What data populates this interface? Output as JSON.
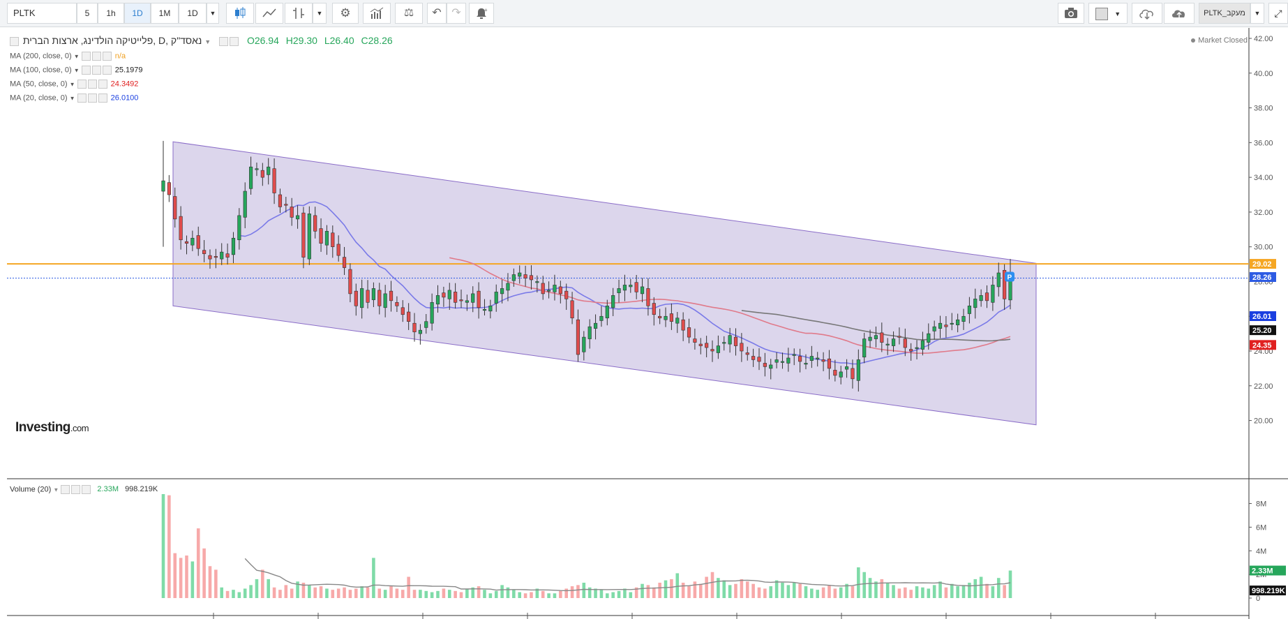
{
  "toolbar": {
    "symbol": "PLTK",
    "intervals": [
      "5",
      "1h",
      "1D",
      "1M",
      "1D"
    ],
    "active_interval_index": 2,
    "watchlist_label": "PLTK_מעקב"
  },
  "legend": {
    "title": "נאסד\"ק ,D ,פלייטיקה הולדינג, ארצות הברית",
    "open": "O26.94",
    "high": "H29.30",
    "low": "L26.40",
    "close": "C28.26",
    "ma": [
      {
        "label": "MA (200, close, 0)",
        "value": "n/a",
        "color": "#f0a020"
      },
      {
        "label": "MA (100, close, 0)",
        "value": "25.1979",
        "color": "#222222"
      },
      {
        "label": "MA (50, close, 0)",
        "value": "24.3492",
        "color": "#e02020"
      },
      {
        "label": "MA (20, close, 0)",
        "value": "26.0100",
        "color": "#1a3fe0"
      }
    ],
    "market_status": "Market Closed"
  },
  "volume_legend": {
    "label": "Volume (20)",
    "value1": "2.33M",
    "value2": "998.219K"
  },
  "logo": {
    "main": "Investing",
    "suffix": ".com"
  },
  "colors": {
    "up": "#26a65b",
    "down": "#e04c4c",
    "channel_fill": "#d8d2ea",
    "channel_stroke": "#8a6cc8",
    "horizontal_line": "#f5a623",
    "price_line": "#2d5be3",
    "ma20": "#7a7ae8",
    "ma50": "#e07a8a",
    "ma100": "#777777"
  },
  "chart_data": {
    "type": "candlestick",
    "y_axis": {
      "ticks": [
        "42.00",
        "40.00",
        "38.00",
        "36.00",
        "34.00",
        "32.00",
        "30.00",
        "28.00",
        "26.00",
        "24.00",
        "22.00",
        "20.00"
      ],
      "range": [
        19.3,
        42
      ]
    },
    "price_labels": [
      {
        "value": 29.02,
        "text": "29.02",
        "color": "#f5a623"
      },
      {
        "value": 28.26,
        "text": "28.26",
        "color": "#2d5be3"
      },
      {
        "value": 26.01,
        "text": "26.01",
        "color": "#1a3fe0"
      },
      {
        "value": 25.2,
        "text": "25.20",
        "color": "#111111"
      },
      {
        "value": 24.35,
        "text": "24.35",
        "color": "#e02020"
      }
    ],
    "horizontal_line": 29.02,
    "channel": {
      "upper": [
        36.05,
        29.05
      ],
      "lower": [
        26.6,
        19.75
      ]
    },
    "series": [
      {
        "name": "Price",
        "closes": [
          33.8,
          33.0,
          31.6,
          30.4,
          30.2,
          30.5,
          29.9,
          29.6,
          29.3,
          29.4,
          29.7,
          29.4,
          30.5,
          31.8,
          33.2,
          34.6,
          34.5,
          34.0,
          34.6,
          33.1,
          32.3,
          32.4,
          31.7,
          31.8,
          29.4,
          31.9,
          30.9,
          30.2,
          30.9,
          30.0,
          29.5,
          28.8,
          27.3,
          26.6,
          27.6,
          26.8,
          27.6,
          26.6,
          27.3,
          26.9,
          26.6,
          26.1,
          25.7,
          25.1,
          25.2,
          25.7,
          26.8,
          27.2,
          27.1,
          27.5,
          26.8,
          26.9,
          26.9,
          27.3,
          26.5,
          26.4,
          26.6,
          27.4,
          27.6,
          27.9,
          28.4,
          28.5,
          28.2,
          28.1,
          28.0,
          27.3,
          27.5,
          27.8,
          27.3,
          27.0,
          25.9,
          23.8,
          24.8,
          25.4,
          25.6,
          26.0,
          26.6,
          27.2,
          27.6,
          27.8,
          27.8,
          27.4,
          27.7,
          26.6,
          26.1,
          25.9,
          26.0,
          25.7,
          25.9,
          25.2,
          24.8,
          24.5,
          24.3,
          24.2,
          24.0,
          24.3,
          24.5,
          24.9,
          24.3,
          24.0,
          23.8,
          23.5,
          23.4,
          23.1,
          23.2,
          23.5,
          23.4,
          23.6,
          23.8,
          23.4,
          23.3,
          23.7,
          23.6,
          23.4,
          23.0,
          22.6,
          22.8,
          23.1,
          22.4,
          23.5,
          24.7,
          24.8,
          24.9,
          24.5,
          24.4,
          24.7,
          24.8,
          24.2,
          24.0,
          24.2,
          24.6,
          25.0,
          25.4,
          25.6,
          25.4,
          25.6,
          25.8,
          26.0,
          26.6,
          27.0,
          27.2,
          26.9,
          27.8,
          28.5,
          27.0,
          28.2
        ]
      },
      {
        "name": "MA (20, close, 0)",
        "values_from_index": 13
      },
      {
        "name": "MA (50, close, 0)",
        "values_from_index": 49
      },
      {
        "name": "MA (100, close, 0)",
        "values_from_index": 99
      }
    ],
    "volume": {
      "y_ticks": [
        "8M",
        "6M",
        "4M",
        "2M",
        "0"
      ],
      "range": [
        0,
        8.8
      ],
      "last_label": "2.33M",
      "ma_label": "998.219K",
      "values": [
        8.8,
        8.7,
        3.8,
        3.4,
        3.6,
        3.1,
        5.9,
        4.2,
        2.7,
        2.4,
        0.9,
        0.6,
        0.7,
        0.5,
        0.8,
        1.1,
        1.6,
        2.4,
        1.6,
        0.9,
        0.7,
        1.1,
        0.8,
        1.4,
        1.3,
        1.1,
        0.9,
        1.0,
        0.8,
        0.7,
        0.8,
        0.9,
        0.7,
        0.8,
        1.0,
        0.9,
        3.4,
        0.8,
        0.7,
        1.0,
        0.8,
        0.7,
        1.8,
        0.7,
        0.7,
        0.6,
        0.5,
        0.6,
        0.8,
        0.7,
        0.6,
        0.5,
        0.8,
        0.9,
        1.0,
        0.7,
        0.4,
        0.6,
        1.1,
        0.9,
        0.7,
        0.5,
        0.4,
        0.5,
        0.8,
        0.6,
        0.4,
        0.4,
        0.6,
        0.8,
        1.0,
        1.1,
        1.3,
        0.9,
        0.8,
        0.7,
        0.4,
        0.5,
        0.6,
        0.8,
        0.5,
        0.9,
        1.2,
        1.1,
        0.9,
        1.3,
        1.5,
        1.6,
        2.1,
        1.3,
        1.0,
        1.4,
        1.2,
        1.8,
        2.2,
        1.7,
        1.5,
        1.1,
        1.2,
        1.6,
        1.4,
        1.2,
        0.9,
        0.8,
        1.0,
        1.5,
        1.3,
        1.1,
        1.3,
        1.2,
        1.0,
        0.8,
        0.7,
        0.9,
        1.1,
        0.8,
        0.9,
        1.2,
        1.0,
        2.6,
        2.2,
        1.7,
        1.4,
        1.6,
        1.3,
        1.1,
        0.8,
        0.9,
        0.7,
        1.0,
        0.9,
        0.8,
        1.1,
        1.4,
        0.9,
        1.2,
        1.0,
        1.1,
        1.3,
        1.6,
        1.8,
        1.2,
        1.0,
        1.7,
        1.1,
        2.33
      ]
    },
    "x_axis": {
      "ticks": [
        "",
        "",
        "",
        "",
        "",
        "",
        "",
        "",
        "",
        "",
        "",
        ""
      ]
    }
  }
}
